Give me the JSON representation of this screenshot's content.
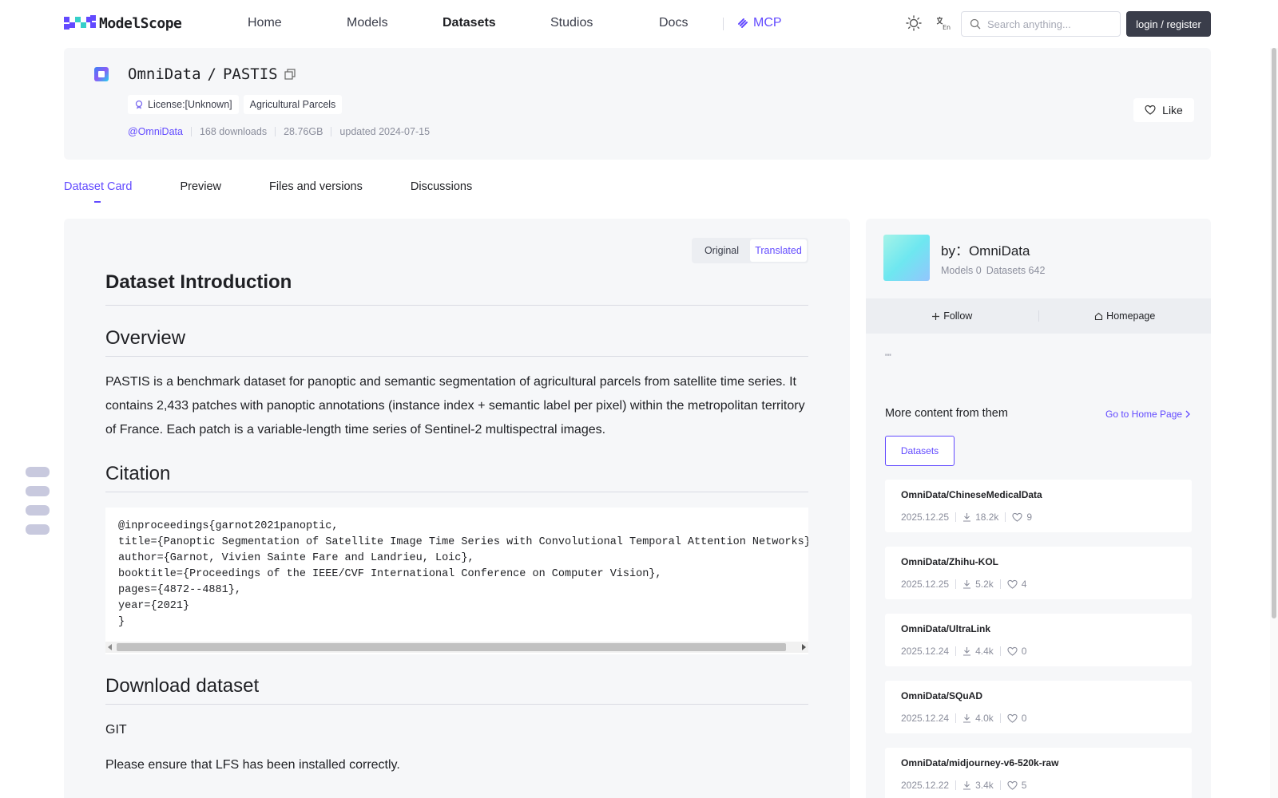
{
  "brand": {
    "name": "ModelScope"
  },
  "nav": {
    "items": [
      {
        "label": "Home"
      },
      {
        "label": "Models"
      },
      {
        "label": "Datasets"
      },
      {
        "label": "Studios"
      },
      {
        "label": "Docs"
      }
    ],
    "mcp_label": "MCP",
    "search_placeholder": "Search anything...",
    "login_label": "login / register"
  },
  "dataset": {
    "owner": "OmniData",
    "name": "PASTIS",
    "title_sep": "/",
    "tags": [
      "License:[Unknown]",
      "Agricultural Parcels"
    ],
    "owner_handle": "@OmniData",
    "downloads": "168 downloads",
    "size": "28.76GB",
    "updated": "updated 2024-07-15",
    "like_label": "Like"
  },
  "tabs": [
    "Dataset Card",
    "Preview",
    "Files and versions",
    "Discussions"
  ],
  "toggle": {
    "original": "Original",
    "translated": "Translated"
  },
  "card": {
    "intro_heading": "Dataset Introduction",
    "overview_heading": "Overview",
    "overview_text": "PASTIS is a benchmark dataset for panoptic and semantic segmentation of agricultural parcels from satellite time series. It contains 2,433 patches with panoptic annotations (instance index + semantic label per pixel) within the metropolitan territory of France. Each patch is a variable-length time series of Sentinel-2 multispectral images.",
    "citation_heading": "Citation",
    "citation_code": "@inproceedings{garnot2021panoptic,\ntitle={Panoptic Segmentation of Satellite Image Time Series with Convolutional Temporal Attention Networks},\nauthor={Garnot, Vivien Sainte Fare and Landrieu, Loic},\nbooktitle={Proceedings of the IEEE/CVF International Conference on Computer Vision},\npages={4872--4881},\nyear={2021}\n}",
    "download_heading": "Download dataset",
    "git_label": "GIT",
    "lfs_note": "Please ensure that LFS has been installed correctly."
  },
  "author": {
    "by_label": "by：OmniData",
    "models": "Models 0",
    "datasets": "Datasets 642",
    "follow_label": "Follow",
    "homepage_label": "Homepage",
    "quote": "\"\""
  },
  "more": {
    "title": "More content from them",
    "link_label": "Go to Home Page",
    "filter_label": "Datasets",
    "items": [
      {
        "name": "OmniData/ChineseMedicalData",
        "date": "2025.12.25",
        "downloads": "18.2k",
        "likes": "9"
      },
      {
        "name": "OmniData/Zhihu-KOL",
        "date": "2025.12.25",
        "downloads": "5.2k",
        "likes": "4"
      },
      {
        "name": "OmniData/UltraLink",
        "date": "2025.12.24",
        "downloads": "4.4k",
        "likes": "0"
      },
      {
        "name": "OmniData/SQuAD",
        "date": "2025.12.24",
        "downloads": "4.0k",
        "likes": "0"
      },
      {
        "name": "OmniData/midjourney-v6-520k-raw",
        "date": "2025.12.22",
        "downloads": "3.4k",
        "likes": "5"
      }
    ]
  },
  "colors": {
    "accent": "#624aff",
    "dark_button": "#3a3d4a",
    "panel": "#f6f7f9"
  }
}
